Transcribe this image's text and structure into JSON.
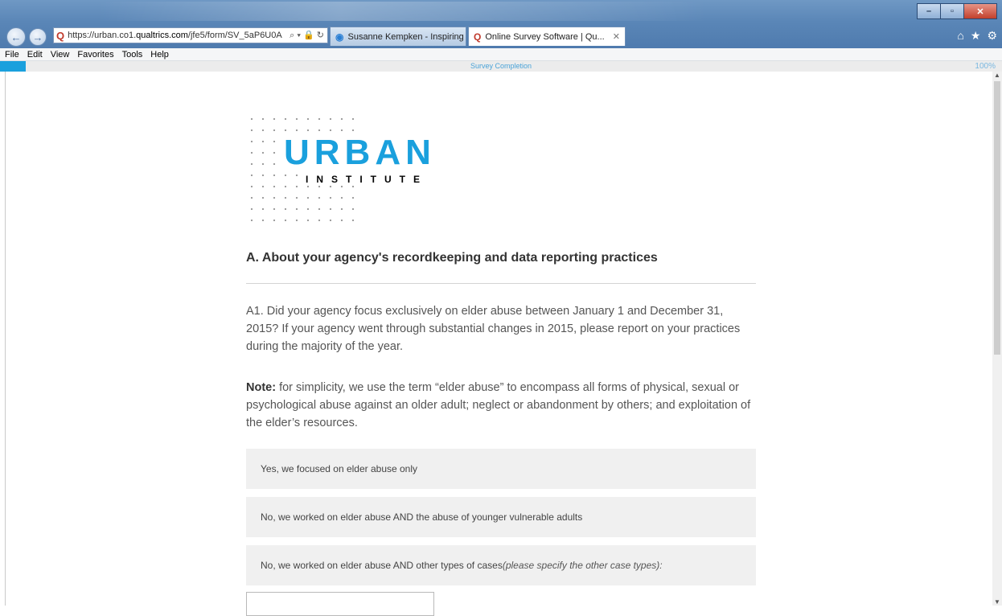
{
  "browser": {
    "url_prefix": "https://urban.co1.",
    "url_domain": "qualtrics.com",
    "url_path": "/jfe5/form/SV_5aP6U0A",
    "address_tools": "⌕ ▾ 🔒 ↻",
    "tabs": [
      {
        "label": "Susanne Kempken - Inspiring ..."
      },
      {
        "label": "Online Survey Software | Qu..."
      }
    ],
    "menu": [
      "File",
      "Edit",
      "View",
      "Favorites",
      "Tools",
      "Help"
    ]
  },
  "progress": {
    "label": "Survey Completion",
    "percent_text": "100%",
    "value": 100
  },
  "logo": {
    "word1": "URBAN",
    "word2": "INSTITUTE"
  },
  "section": {
    "title": "A. About your agency's recordkeeping and data reporting practices"
  },
  "question": {
    "text": "A1. Did your agency focus exclusively on elder abuse between January 1 and December 31, 2015? If your agency went through substantial changes in 2015, please report on your practices during the majority of the year.",
    "note_label": "Note:",
    "note_text": " for simplicity, we use the term “elder abuse” to encompass all forms of physical, sexual or psychological abuse against an older adult; neglect or abandonment by others; and exploitation of the elder’s resources."
  },
  "choices": [
    {
      "label": "Yes, we focused on elder abuse only"
    },
    {
      "label": "No, we worked on elder abuse AND the abuse of younger vulnerable adults"
    },
    {
      "label": "No, we worked on elder abuse AND other types of cases ",
      "italic": "(please specify the other case types):"
    }
  ],
  "colors": {
    "accent": "#1aa0dd",
    "choice_bg": "#f0f0f0"
  }
}
